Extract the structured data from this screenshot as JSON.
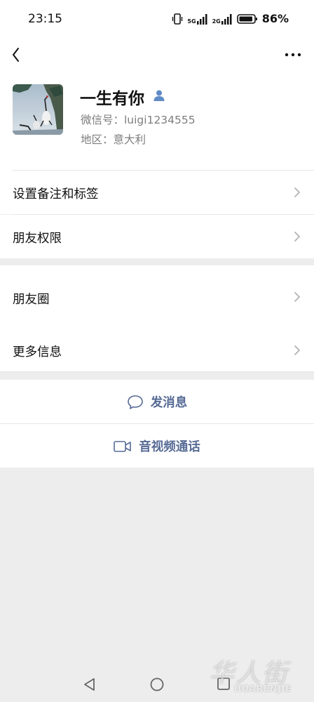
{
  "status_bar": {
    "time": "23:15",
    "network_5g": "5G",
    "network_2g": "2G",
    "battery": "86%"
  },
  "profile": {
    "name": "一生有你",
    "wechat_id": "微信号：luigi1234555",
    "region": "地区：意大利"
  },
  "menu": {
    "remarks_tags": "设置备注和标签",
    "friend_permissions": "朋友权限",
    "moments": "朋友圈",
    "more_info": "更多信息"
  },
  "actions": {
    "send_message": "发消息",
    "video_call": "音视频通话"
  },
  "watermark": {
    "text": "华人街",
    "subtext": "HUARENJIE"
  },
  "colors": {
    "link_blue": "#576b95",
    "background": "#ededed"
  }
}
